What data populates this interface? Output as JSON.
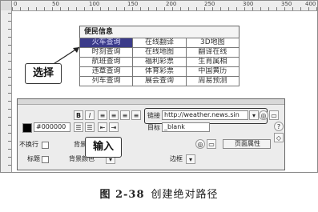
{
  "ruler": {
    "ticks": [
      "0",
      "50",
      "100",
      "150",
      "200",
      "250",
      "300",
      "350",
      "400"
    ]
  },
  "table": {
    "header": "便民信息",
    "rows": [
      [
        "火车查询",
        "在线翻译",
        "3D地图"
      ],
      [
        "时刻查询",
        "在线地图",
        "翻译在线"
      ],
      [
        "航班查询",
        "福利彩票",
        "生肖属相"
      ],
      [
        "违章查询",
        "体育彩票",
        "中国黄历"
      ],
      [
        "列车查询",
        "展会查询",
        "周易预测"
      ]
    ],
    "selected_cell": "火车查询"
  },
  "callouts": {
    "select": "选择",
    "input": "输入"
  },
  "properties_panel": {
    "bold_label": "B",
    "italic_label": "I",
    "color_value": "#000000",
    "link_label": "链接",
    "link_value": "http://weather.news.sin",
    "target_label": "目标",
    "target_value": "_blank",
    "nowrap_label": "不换行",
    "bg_label": "背景",
    "header_label": "标题",
    "bg_color_label": "背景颜色",
    "border_label": "边框",
    "page_props_button": "页面属性",
    "help_icon": "?"
  },
  "caption": {
    "figure_no": "图 2-38",
    "title": "创建绝对路径"
  }
}
